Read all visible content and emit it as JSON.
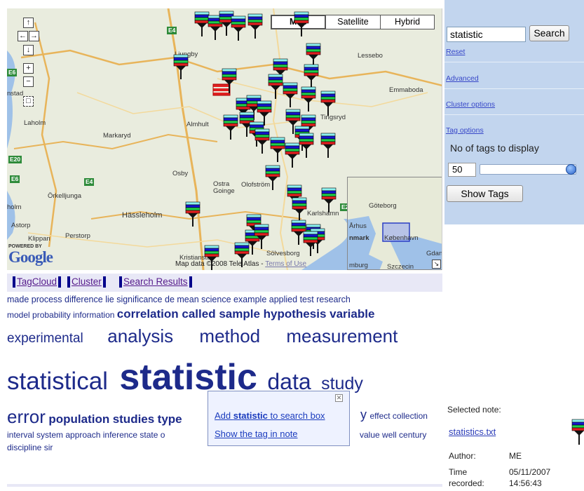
{
  "map": {
    "types": [
      "Map",
      "Satellite",
      "Hybrid"
    ],
    "active_type": "Map",
    "nav_symbols": [
      "↑",
      "←",
      "→",
      "↓",
      "+",
      "−",
      "□"
    ],
    "places": [
      "Ljungby",
      "Lessebo",
      "Emmaboda",
      "Laholm",
      "Markaryd",
      "Almhult",
      "Tingsryd",
      "Osby",
      "Ostra Goinge",
      "Olofström",
      "Örkelljunga",
      "Hässleholm",
      "Astorp",
      "Perstorp",
      "Klippan",
      "Karlshamn",
      "Sölvesborg",
      "Kristianstad",
      "holm",
      "nstad"
    ],
    "roads": [
      "E4",
      "E6",
      "E20",
      "E6",
      "E4",
      "E2"
    ],
    "overview_places": [
      "Göteborg",
      "Århus",
      "nmark",
      "København",
      "Gdan",
      "mburg",
      "Szczecin"
    ],
    "powered_by": "POWERED BY",
    "logo": "Google",
    "attribution": "Map data ©2008 Tele Atlas - ",
    "terms_link": "Terms of Use",
    "corner_icon": "↘"
  },
  "tabs": [
    "TagCloud",
    "Cluster",
    "Search Results"
  ],
  "cloud": {
    "line1": [
      "made",
      "process",
      "difference",
      "lie",
      "significance",
      "de",
      "mean",
      "science",
      "example",
      "applied",
      "test",
      "research"
    ],
    "line2": [
      "model",
      "probability",
      "information"
    ],
    "line2_big": [
      "correlation",
      "called",
      "sample",
      "hypothesis",
      "variable"
    ],
    "line3_a": "experimental",
    "line3_b": [
      "analysis",
      "method",
      "measurement"
    ],
    "line4_a": "statistical",
    "line4_b": "statistic",
    "line4_c": "data",
    "line4_d": "study",
    "line5_a": "error",
    "line5_b": "population",
    "line5_c": "studies",
    "line5_d": "type",
    "line5_e": "y",
    "line5_f": "effect collection",
    "line6_a": "interval system approach inference state o",
    "line6_b": "value well century",
    "line7": "discipline sir"
  },
  "popup": {
    "close": "✕",
    "action1_pre": "Add ",
    "action1_bold": "statistic",
    "action1_post": " to search box",
    "action2": "Show the tag in note"
  },
  "panel": {
    "search_value": "statistic",
    "search_button": "Search",
    "reset": "Reset",
    "advanced": "Advanced",
    "cluster_options": "Cluster options",
    "tag_options": "Tag options",
    "tags_label": "No of tags to display",
    "tags_value": "50",
    "tags_fraction": 1.0,
    "show_tags": "Show Tags",
    "selected_note_label": "Selected note:",
    "note_file": "statistics.txt",
    "author_label": "Author:",
    "author": "ME",
    "time_label_1": "Time",
    "time_label_2": "recorded:",
    "date": "05/11/2007",
    "time": "14:56:43"
  },
  "colors": {
    "tag_link": "#551a8b",
    "cloud_text": "#1d2a8a",
    "panel_bg": "#c2d5ee",
    "marker_cyan": "#8cf1f1",
    "marker_blue": "#1515d0",
    "marker_green": "#1ecf4a",
    "marker_red": "#e02020"
  }
}
